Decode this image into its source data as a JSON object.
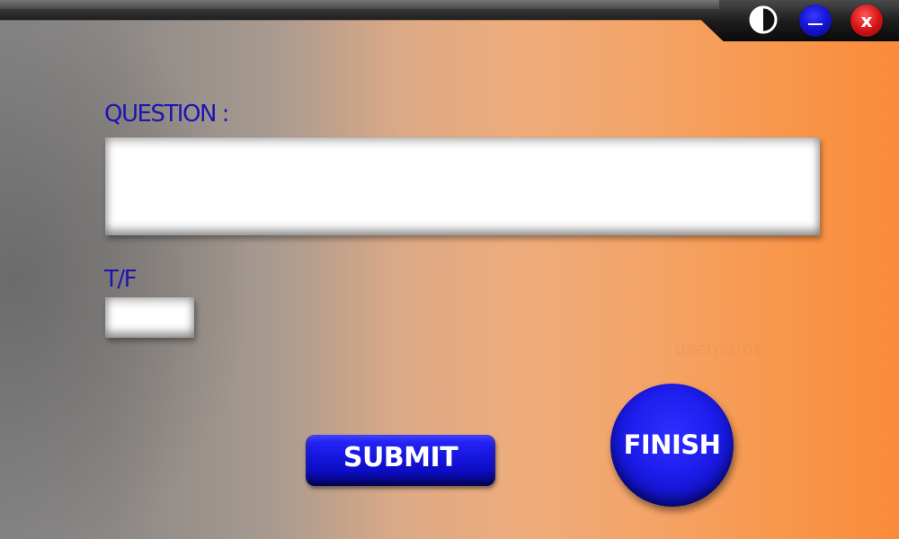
{
  "window": {
    "controls": {
      "theme_icon": "contrast-icon",
      "minimize_icon": "minimize-icon",
      "close_icon": "close-icon",
      "close_label": "x"
    }
  },
  "form": {
    "question_label": "QUESTION :",
    "question_value": "",
    "tf_label": "T/F",
    "tf_value": "",
    "watermark": "username"
  },
  "actions": {
    "submit_label": "SUBMIT",
    "finish_label": "FINISH"
  },
  "colors": {
    "label": "#1d16b0",
    "button_blue": "#1a1ae8",
    "close_red": "#d81616",
    "background_left": "#858585",
    "background_right": "#fb8a3a"
  }
}
